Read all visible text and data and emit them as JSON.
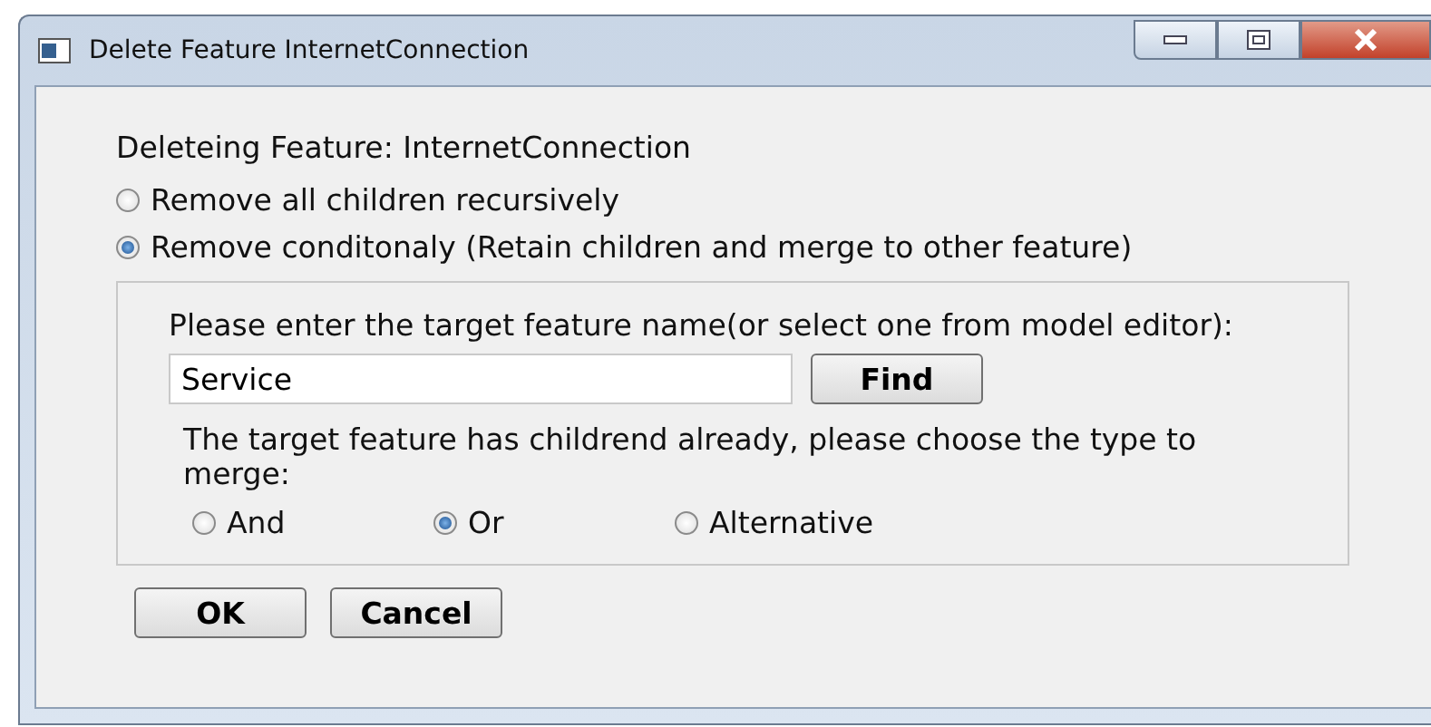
{
  "window": {
    "title": "Delete Feature InternetConnection"
  },
  "heading": "Deleteing Feature: InternetConnection",
  "remove_options": [
    {
      "label": "Remove all children recursively",
      "selected": false
    },
    {
      "label": "Remove conditonaly (Retain children and merge to other feature)",
      "selected": true
    }
  ],
  "target": {
    "label": "Please enter the target feature name(or select one from model editor):",
    "value": "Service",
    "find_button": "Find"
  },
  "merge": {
    "prompt": "The target feature has childrend already, please choose the type to merge:",
    "options": [
      {
        "label": "And",
        "selected": false
      },
      {
        "label": "Or",
        "selected": true
      },
      {
        "label": "Alternative",
        "selected": false
      }
    ]
  },
  "buttons": [
    "OK",
    "Cancel"
  ]
}
